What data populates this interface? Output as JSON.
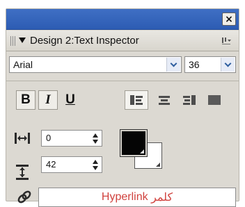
{
  "panel": {
    "close_label": "×",
    "title": "Design 2:Text Inspector",
    "options_icon": "options-icon"
  },
  "font": {
    "family_value": "Arial",
    "size_value": "36"
  },
  "style_buttons": {
    "bold": "B",
    "italic": "I",
    "underline": "U",
    "bold_pressed": true,
    "italic_pressed": true
  },
  "alignment": {
    "options": [
      "left",
      "center",
      "right",
      "justify"
    ],
    "selected": "left"
  },
  "tracking": {
    "value": "0"
  },
  "leading": {
    "value": "42"
  },
  "text_color": "#050505",
  "hyperlink": {
    "value": "Hyperlink",
    "value_rtl": "كلمر"
  },
  "colors": {
    "titlebar": "#2d5cb3",
    "panel_bg": "#dcd9d2",
    "hyperlink_text": "#d0413d"
  }
}
